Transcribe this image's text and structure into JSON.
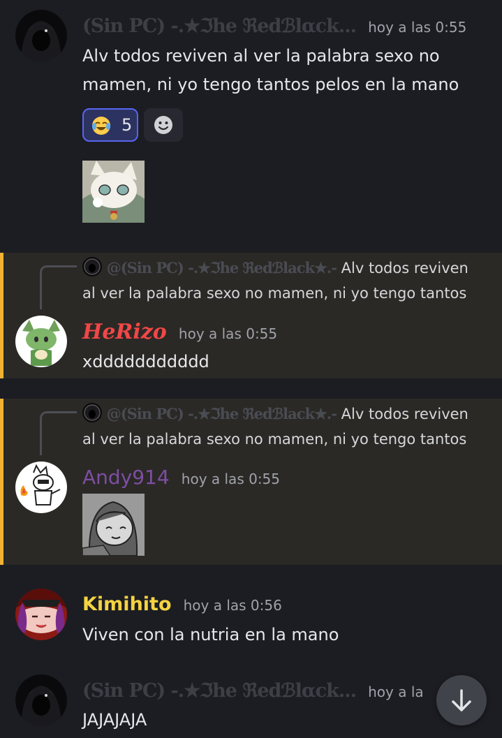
{
  "messages": [
    {
      "author": "(Sin PC) -.★ℑhe ℜedℬlαck...",
      "timestamp": "hoy a las 0:55",
      "text_line1": "Alv todos reviven al ver la palabra sexo no",
      "text_line2": "mamen, ni yo tengo tantos pelos en la mano",
      "reactions": [
        {
          "emoji": "joy-emoji-icon",
          "count": "5"
        }
      ],
      "add_reaction_icon": "smiley-add-reaction-icon",
      "attachment": "cat-character-sticker"
    },
    {
      "reply_to": {
        "author": "@(Sin PC) -.★ℑhe ℜedℬlack★.-",
        "text_line1": "Alv todos reviven",
        "text_line2": "al ver la palabra sexo no mamen, ni yo tengo tantos"
      },
      "author": "HeRizo",
      "author_color": "#f04747",
      "timestamp": "hoy a las 0:55",
      "text": "xddddddddddd"
    },
    {
      "reply_to": {
        "author": "@(Sin PC) -.★ℑhe ℜedℬlack★.-",
        "text_line1": "Alv todos reviven",
        "text_line2": "al ver la palabra sexo no mamen, ni yo tengo tantos"
      },
      "author": "Andy914",
      "author_color": "#7d4ea3",
      "timestamp": "hoy a las 0:55",
      "attachment": "grayscale-character-sticker"
    },
    {
      "author": "Kimihito",
      "author_color": "#f5d342",
      "timestamp": "hoy a las 0:56",
      "text": "Viven con la nutria en la mano"
    },
    {
      "author": "(Sin PC) -.★ℑhe ℜedℬlαck...",
      "timestamp": "hoy a la",
      "text": "JAJAJAJA"
    }
  ],
  "colors": {
    "background": "#1c1d22",
    "highlight_bg": "#2b2926",
    "mention_bar": "#f0b232",
    "reaction_active_border": "#5865f2"
  },
  "scroll_to_bottom_icon": "arrow-down-icon"
}
